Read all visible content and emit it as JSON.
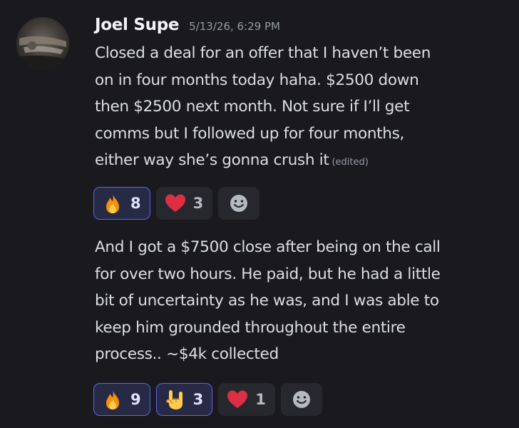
{
  "author": {
    "name": "Joel Supe",
    "timestamp": "5/13/26, 6:29 PM"
  },
  "messages": [
    {
      "lines": [
        "Closed a deal for an offer that I haven’t been",
        "on in four months today haha. $2500  down",
        "then $2500 next month. Not sure if I’ll get",
        "comms but I followed up for four months,",
        "either way she’s gonna crush it"
      ],
      "edited_label": "(edited)",
      "reactions": [
        {
          "emoji": "fire-emoji",
          "count": "8",
          "me": true
        },
        {
          "emoji": "heart-emoji",
          "count": "3",
          "me": false
        }
      ]
    },
    {
      "lines": [
        "And I got a $7500 close after being on the call",
        "for over two hours. He paid, but he had a little",
        "bit of uncertainty as he was, and I was able to",
        "keep him grounded throughout the entire",
        "process.. ~$4k collected"
      ],
      "reactions": [
        {
          "emoji": "fire-emoji",
          "count": "9",
          "me": true
        },
        {
          "emoji": "sign-of-the-horns-emoji",
          "count": "3",
          "me": true
        },
        {
          "emoji": "heart-emoji",
          "count": "1",
          "me": false
        }
      ]
    }
  ],
  "colors": {
    "background": "#1a1a1e",
    "username": "#f2f3f5",
    "text": "#dbdee1",
    "muted": "#949ba4",
    "reaction_me_border": "#5865f2",
    "reaction_me_bg": "#272a45",
    "reaction_bg": "#27282d"
  }
}
